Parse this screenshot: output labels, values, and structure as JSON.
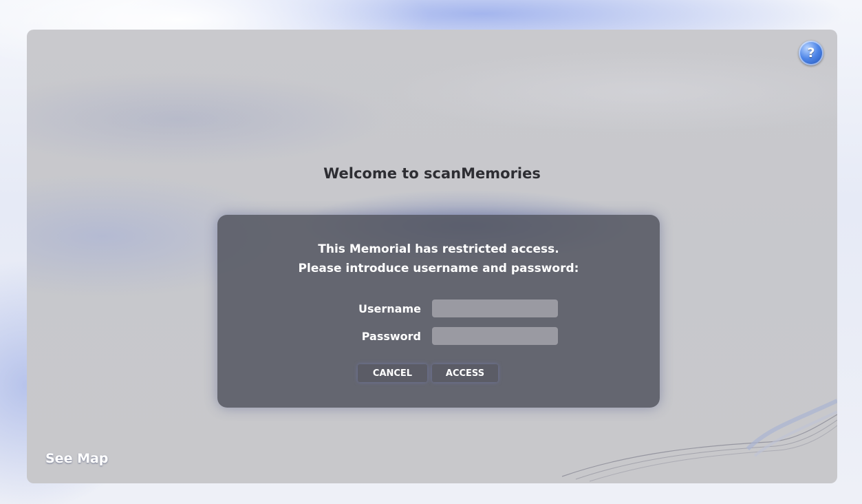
{
  "header": {
    "help_symbol": "?",
    "help_icon": "help-icon"
  },
  "main": {
    "welcome": "Welcome to scanMemories"
  },
  "dialog": {
    "message_line1": "This Memorial has restricted access.",
    "message_line2": "Please introduce username and password:",
    "username_label": "Username",
    "password_label": "Password",
    "username_value": "",
    "password_value": "",
    "cancel_label": "CANCEL",
    "access_label": "ACCESS"
  },
  "footer": {
    "see_map_label": "See Map"
  },
  "colors": {
    "help_accent": "#4f86e8",
    "dialog_bg": "#4e505c",
    "input_bg": "#9a9aa2",
    "button_bg": "#5b5c66"
  }
}
